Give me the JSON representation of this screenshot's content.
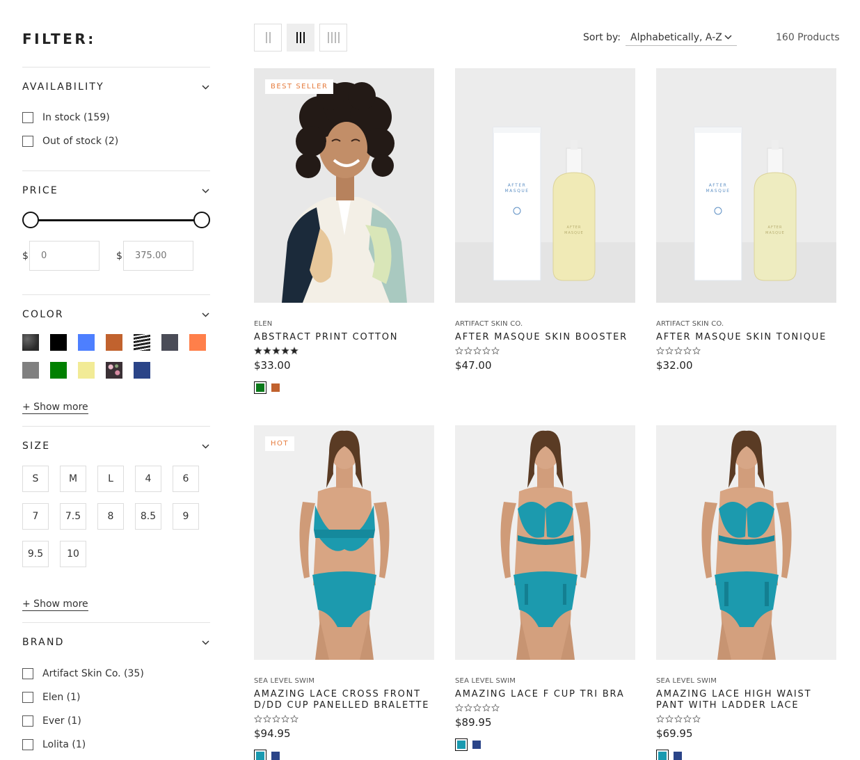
{
  "filter": {
    "title": "FILTER:",
    "availability": {
      "title": "AVAILABILITY",
      "options": [
        {
          "label": "In stock (159)"
        },
        {
          "label": "Out of stock (2)"
        }
      ]
    },
    "price": {
      "title": "PRICE",
      "currency": "$",
      "min_value": "0",
      "max_value": "375.00",
      "range_min_fraction": 0,
      "range_max_fraction": 1
    },
    "color": {
      "title": "COLOR",
      "swatches": [
        {
          "name": "charcoal-texture",
          "color": "#3a3a3a"
        },
        {
          "name": "black",
          "color": "#000000"
        },
        {
          "name": "blue",
          "color": "#4d7fff"
        },
        {
          "name": "rust",
          "color": "#c1622e"
        },
        {
          "name": "stripes",
          "color": "#222222"
        },
        {
          "name": "slate",
          "color": "#4a4c57"
        },
        {
          "name": "orange",
          "color": "#ff7f4a"
        },
        {
          "name": "gray",
          "color": "#808080"
        },
        {
          "name": "green",
          "color": "#008000"
        },
        {
          "name": "light-yellow",
          "color": "#f2eb96"
        },
        {
          "name": "floral",
          "color": "#5c4a52"
        },
        {
          "name": "navy",
          "color": "#2a4488"
        }
      ],
      "show_more": "+ Show more"
    },
    "size": {
      "title": "SIZE",
      "options": [
        "S",
        "M",
        "L",
        "4",
        "6",
        "7",
        "7.5",
        "8",
        "8.5",
        "9",
        "9.5",
        "10"
      ],
      "show_more": "+ Show more"
    },
    "brand": {
      "title": "BRAND",
      "options": [
        {
          "label": "Artifact Skin Co. (35)"
        },
        {
          "label": "Elen (1)"
        },
        {
          "label": "Ever (1)"
        },
        {
          "label": "Lolita (1)"
        }
      ]
    }
  },
  "toolbar": {
    "sort_label": "Sort by:",
    "sort_value": "Alphabetically, A-Z",
    "product_count": "160 Products"
  },
  "products": [
    {
      "badge": "BEST SELLER",
      "brand": "ELEN",
      "title": "ABSTRACT PRINT COTTON",
      "rating": 5,
      "price": "$33.00",
      "swatches": [
        "#0a7a1a",
        "#c1622e"
      ]
    },
    {
      "badge": "",
      "brand": "ARTIFACT SKIN CO.",
      "title": "AFTER MASQUE SKIN BOOSTER",
      "rating": 0,
      "price": "$47.00",
      "swatches": []
    },
    {
      "badge": "",
      "brand": "ARTIFACT SKIN CO.",
      "title": "AFTER MASQUE SKIN TONIQUE",
      "rating": 0,
      "price": "$32.00",
      "swatches": []
    },
    {
      "badge": "HOT",
      "brand": "SEA LEVEL SWIM",
      "title": "AMAZING LACE CROSS FRONT D/DD CUP PANELLED BRALETTE",
      "rating": 0,
      "price": "$94.95",
      "swatches": [
        "#1a9ab0",
        "#2a4488"
      ]
    },
    {
      "badge": "",
      "brand": "SEA LEVEL SWIM",
      "title": "AMAZING LACE F CUP TRI BRA",
      "rating": 0,
      "price": "$89.95",
      "swatches": [
        "#1a9ab0",
        "#2a4488"
      ]
    },
    {
      "badge": "",
      "brand": "SEA LEVEL SWIM",
      "title": "AMAZING LACE HIGH WAIST PANT WITH LADDER LACE",
      "rating": 0,
      "price": "$69.95",
      "swatches": [
        "#1a9ab0",
        "#2a4488"
      ]
    }
  ]
}
